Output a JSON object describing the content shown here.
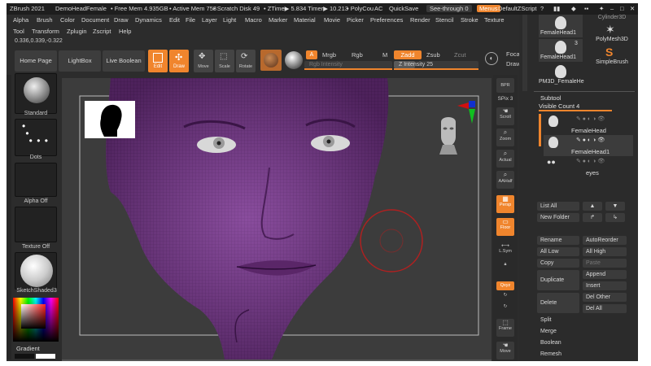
{
  "titlebar": {
    "app": "ZBrush 2021",
    "doc": "DemoHeadFemale",
    "mem_free": "• Free Mem 4.935GB",
    "mem_active": "• Active Mem 758",
    "scratch": "• Scratch Disk 49",
    "ztime": "• ZTime▶ 5.834 Timer▶ 10.213",
    "polycount": "• PolyCou",
    "ac": "AC",
    "quicksave": "QuickSave",
    "seethrough": "See-through  0",
    "menus": "Menus",
    "defaultzscript": "DefaultZScript"
  },
  "menubar": {
    "items": [
      "Alpha",
      "Brush",
      "Color",
      "Document",
      "Draw",
      "Dynamics",
      "Edit",
      "File",
      "Layer",
      "Light",
      "Macro",
      "Marker",
      "Material",
      "Movie",
      "Picker",
      "Preferences",
      "Render",
      "Stencil",
      "Stroke",
      "Texture"
    ],
    "items2": [
      "Tool",
      "Transform",
      "Zplugin",
      "Zscript",
      "Help"
    ]
  },
  "coords": "0.336,0.339,-0.322",
  "toolbar": {
    "home": "Home Page",
    "lightbox": "LightBox",
    "liveboolean": "Live Boolean",
    "edit": "Edit",
    "draw": "Draw",
    "move": "Move",
    "scale": "Scale",
    "rotate": "Rotate",
    "a": "A",
    "mrgb": "Mrgb",
    "rgb": "Rgb",
    "m": "M",
    "zadd": "Zadd",
    "zsub": "Zsub",
    "zcut": "Zcut",
    "rgb_intensity": "Rgb Intensity",
    "z_intensity": "Z Intensity 25",
    "z_intensity_value": 0.25,
    "focal": "Foca",
    "draw_size": "Draw"
  },
  "left_panel": {
    "brush": "Standard",
    "stroke": "Dots",
    "alpha": "Alpha Off",
    "texture": "Texture Off",
    "material": "SketchShaded3",
    "gradient": "Gradient"
  },
  "right_tools": {
    "bpr": "BPR",
    "spix": "SPix 3",
    "scroll": "Scroll",
    "zoom": "Zoom",
    "actual": "Actual",
    "aahalf": "AAHalf",
    "persp": "Persp",
    "floor": "Floor",
    "lsym": "L.Sym",
    "xyz": "Qxyz",
    "frame": "Frame",
    "move": "Move"
  },
  "tool_panel": {
    "thumbs": [
      "FemaleHead1",
      "FemaleHead1",
      "PM3D_FemaleHe"
    ],
    "thumb_count": "3",
    "polymesh": "PolyMesh3D",
    "simplebrush": "SimpleBrush",
    "cylinder": "Cylinder3D",
    "subtool_title": "Subtool",
    "visible_count": "Visible Count 4",
    "subtools": [
      "FemaleHead",
      "FemaleHead1",
      "eyes"
    ],
    "buttons": {
      "list_all": "List All",
      "new_folder": "New Folder",
      "rename": "Rename",
      "autoreorder": "AutoReorder",
      "all_low": "All Low",
      "all_high": "All High",
      "copy": "Copy",
      "paste": "Paste",
      "duplicate": "Duplicate",
      "append": "Append",
      "insert": "Insert",
      "delete": "Delete",
      "del_other": "Del Other",
      "del_all": "Del All",
      "split": "Split",
      "merge": "Merge",
      "boolean": "Boolean",
      "remesh": "Remesh"
    }
  },
  "colors": {
    "accent": "#f0852d",
    "mesh": "#7a3d8c",
    "brush_ring": "#b02020"
  }
}
